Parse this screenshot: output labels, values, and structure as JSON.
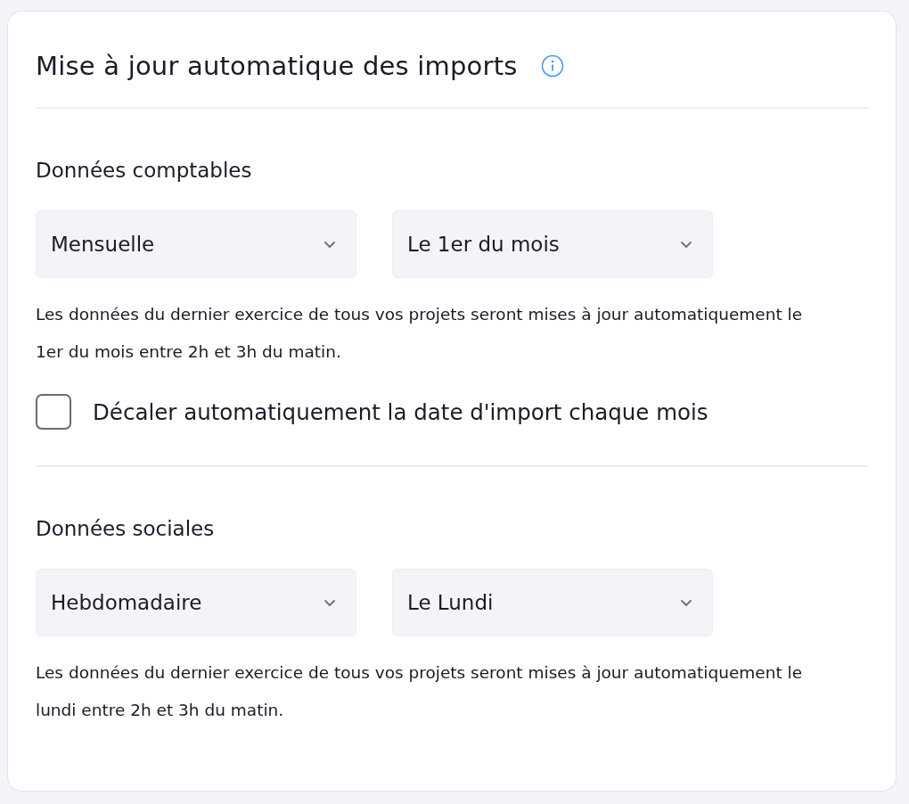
{
  "card": {
    "title": "Mise à jour automatique des imports"
  },
  "sections": [
    {
      "heading": "Données comptables",
      "selects": [
        {
          "value": "Mensuelle"
        },
        {
          "value": "Le 1er du mois"
        }
      ],
      "description": "Les données du dernier exercice de tous vos projets seront mises à jour automatiquement le 1er du mois entre 2h et 3h du matin.",
      "option": {
        "label": "Décaler automatiquement la date d'import chaque mois",
        "checked": false
      }
    },
    {
      "heading": "Données sociales",
      "selects": [
        {
          "value": "Hebdomadaire"
        },
        {
          "value": "Le Lundi"
        }
      ],
      "description": "Les données du dernier exercice de tous vos projets seront mises à jour automatiquement le lundi entre 2h et 3h du matin."
    }
  ]
}
